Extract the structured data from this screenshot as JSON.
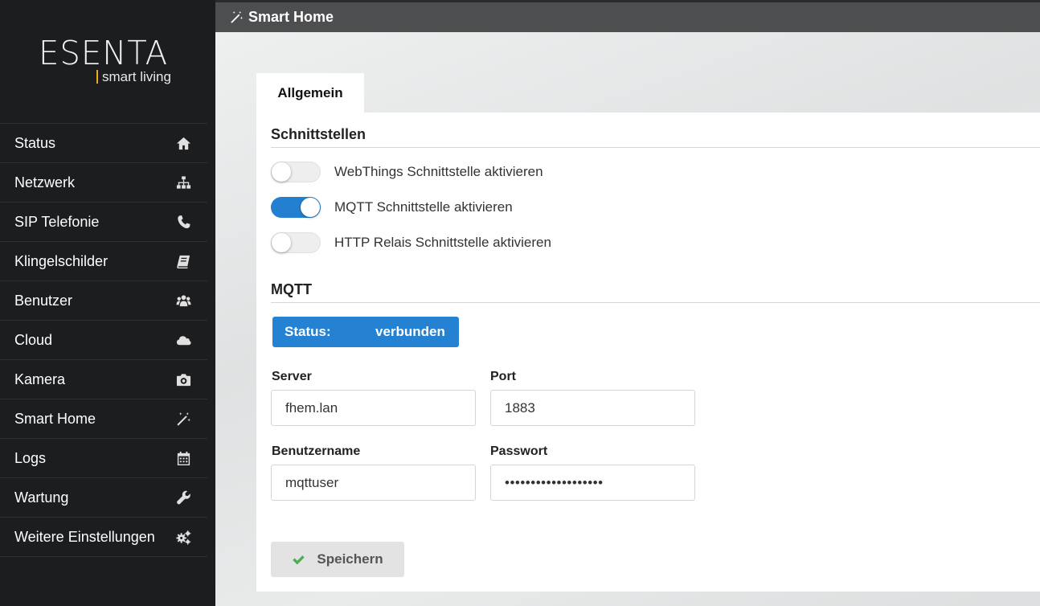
{
  "sidebar": {
    "logo_main": "ESENTA",
    "logo_sub": "smart living",
    "items": [
      {
        "label": "Status",
        "icon": "home-icon"
      },
      {
        "label": "Netzwerk",
        "icon": "sitemap-icon"
      },
      {
        "label": "SIP Telefonie",
        "icon": "phone-icon"
      },
      {
        "label": "Klingelschilder",
        "icon": "book-icon"
      },
      {
        "label": "Benutzer",
        "icon": "users-icon"
      },
      {
        "label": "Cloud",
        "icon": "cloud-icon"
      },
      {
        "label": "Kamera",
        "icon": "camera-icon"
      },
      {
        "label": "Smart Home",
        "icon": "magic-wand-icon"
      },
      {
        "label": "Logs",
        "icon": "calendar-icon"
      },
      {
        "label": "Wartung",
        "icon": "wrench-icon"
      },
      {
        "label": "Weitere Einstellungen",
        "icon": "cogs-icon"
      }
    ]
  },
  "header": {
    "title": "Smart Home",
    "icon": "magic-wand-icon"
  },
  "tabs": [
    {
      "label": "Allgemein",
      "active": true
    }
  ],
  "interfaces": {
    "title": "Schnittstellen",
    "toggles": [
      {
        "label": "WebThings Schnittstelle aktivieren",
        "on": false
      },
      {
        "label": "MQTT Schnittstelle aktivieren",
        "on": true
      },
      {
        "label": "HTTP Relais Schnittstelle aktivieren",
        "on": false
      }
    ]
  },
  "mqtt": {
    "title": "MQTT",
    "status_label": "Status:",
    "status_value": "verbunden",
    "server_label": "Server",
    "server_value": "fhem.lan",
    "port_label": "Port",
    "port_value": "1883",
    "user_label": "Benutzername",
    "user_value": "mqttuser",
    "password_label": "Passwort",
    "password_value": "•••••••••••••••••••"
  },
  "save_label": "Speichern",
  "colors": {
    "accent": "#2582d2",
    "sidebar": "#1c1d1f",
    "topbar": "#4d4e50",
    "logo_bar": "#f0a81e",
    "save_check": "#4cae4c"
  }
}
